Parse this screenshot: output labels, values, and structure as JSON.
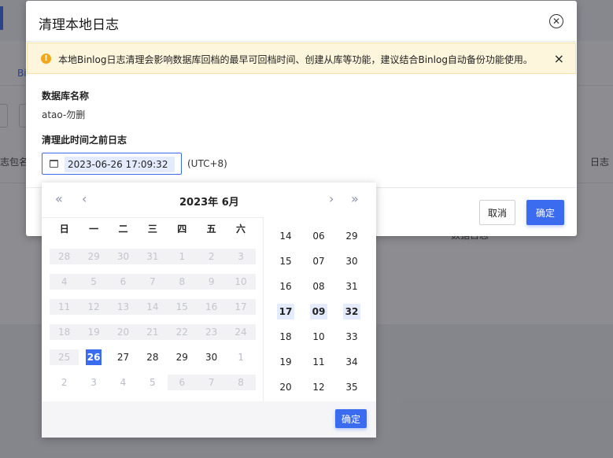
{
  "background": {
    "tab_label": "Bi",
    "column_left": "志包名",
    "column_right": "日志",
    "cell_text": "数据日志"
  },
  "dialog": {
    "title": "清理本地日志",
    "close_icon": "circle-x",
    "alert": {
      "icon": "warning",
      "text": "本地Binlog日志清理会影响数据库回档的最早可回档时间、创建从库等功能，建议结合Binlog自动备份功能使用。",
      "close_glyph": "×"
    },
    "db_name_label": "数据库名称",
    "db_name_value": "atao-勿删",
    "clear_before_label": "清理此时间之前日志",
    "datetime_value": "2023-06-26 17:09:32",
    "timezone": "(UTC+8)",
    "cancel_label": "取消",
    "confirm_label": "确定"
  },
  "picker": {
    "nav": {
      "prev_year": "«",
      "prev_month": "‹",
      "next_month": "›",
      "next_year": "»"
    },
    "title": "2023年  6月",
    "weekdays": [
      "日",
      "一",
      "二",
      "三",
      "四",
      "五",
      "六"
    ],
    "weeks": [
      [
        {
          "v": "28",
          "s": "dis"
        },
        {
          "v": "29",
          "s": "dis"
        },
        {
          "v": "30",
          "s": "dis"
        },
        {
          "v": "31",
          "s": "dis"
        },
        {
          "v": "1",
          "s": "dis"
        },
        {
          "v": "2",
          "s": "dis"
        },
        {
          "v": "3",
          "s": "dis"
        }
      ],
      [
        {
          "v": "4",
          "s": "dis"
        },
        {
          "v": "5",
          "s": "dis"
        },
        {
          "v": "6",
          "s": "dis"
        },
        {
          "v": "7",
          "s": "dis"
        },
        {
          "v": "8",
          "s": "dis"
        },
        {
          "v": "9",
          "s": "dis"
        },
        {
          "v": "10",
          "s": "dis"
        }
      ],
      [
        {
          "v": "11",
          "s": "dis"
        },
        {
          "v": "12",
          "s": "dis"
        },
        {
          "v": "13",
          "s": "dis"
        },
        {
          "v": "14",
          "s": "dis"
        },
        {
          "v": "15",
          "s": "dis"
        },
        {
          "v": "16",
          "s": "dis"
        },
        {
          "v": "17",
          "s": "dis"
        }
      ],
      [
        {
          "v": "18",
          "s": "dis"
        },
        {
          "v": "19",
          "s": "dis"
        },
        {
          "v": "20",
          "s": "dis"
        },
        {
          "v": "21",
          "s": "dis"
        },
        {
          "v": "22",
          "s": "dis"
        },
        {
          "v": "23",
          "s": "dis"
        },
        {
          "v": "24",
          "s": "dis"
        }
      ],
      [
        {
          "v": "25",
          "s": "dis"
        },
        {
          "v": "26",
          "s": "sel"
        },
        {
          "v": "27",
          "s": ""
        },
        {
          "v": "28",
          "s": ""
        },
        {
          "v": "29",
          "s": ""
        },
        {
          "v": "30",
          "s": ""
        },
        {
          "v": "1",
          "s": "mut"
        }
      ],
      [
        {
          "v": "2",
          "s": "mut"
        },
        {
          "v": "3",
          "s": "mut"
        },
        {
          "v": "4",
          "s": "mut"
        },
        {
          "v": "5",
          "s": "mut"
        },
        {
          "v": "6",
          "s": "dis"
        },
        {
          "v": "7",
          "s": "dis"
        },
        {
          "v": "8",
          "s": "dis"
        }
      ]
    ],
    "hours": [
      "14",
      "15",
      "16",
      "17",
      "18",
      "19",
      "20"
    ],
    "minutes": [
      "06",
      "07",
      "08",
      "09",
      "10",
      "11",
      "12"
    ],
    "seconds": [
      "29",
      "30",
      "31",
      "32",
      "33",
      "34",
      "35"
    ],
    "selected_hour": "17",
    "selected_minute": "09",
    "selected_second": "32",
    "confirm_label": "确定"
  },
  "colors": {
    "primary": "#3b6cf0",
    "warning": "#f0a719",
    "alert_bg": "#fdf6dc",
    "selected_time_bg": "#e4ebfd"
  }
}
